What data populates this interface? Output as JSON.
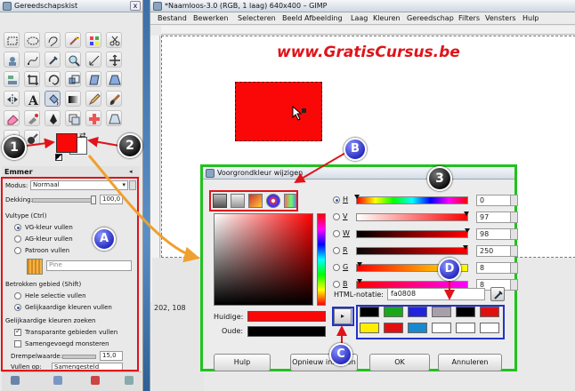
{
  "toolbox": {
    "title": "Gereedschapskist",
    "close": "x",
    "tools": [
      "rect-select-icon",
      "ellipse-select-icon",
      "lasso-icon",
      "fuzzy-select-icon",
      "color-select-icon",
      "scissors-icon",
      "foreground-select-icon",
      "paths-icon",
      "color-picker-icon",
      "zoom-icon",
      "measure-icon",
      "move-icon",
      "align-icon",
      "crop-icon",
      "rotate-icon",
      "scale-icon",
      "shear-icon",
      "perspective-icon",
      "flip-icon",
      "text-icon",
      "bucket-fill-icon",
      "blend-icon",
      "pencil-icon",
      "paintbrush-icon",
      "eraser-icon",
      "airbrush-icon",
      "ink-icon",
      "clone-icon",
      "heal-icon",
      "perspective-clone-icon",
      "smudge-icon",
      "dodge-icon"
    ],
    "fg_color": "#fa0808",
    "bg_color": "#ffffff"
  },
  "options": {
    "title": "Emmer",
    "mode_label": "Modus:",
    "mode_value": "Normaal",
    "opacity_label": "Dekking:",
    "opacity_value": "100,0",
    "fill_type_label": "Vultype  (Ctrl)",
    "fill_fg": "VG-kleur vullen",
    "fill_bg": "AG-kleur vullen",
    "fill_pattern": "Patroon vullen",
    "pattern_name": "Pine",
    "area_label": "Betrokken gebied  (Shift)",
    "area_selection": "Hele selectie vullen",
    "area_similar": "Gelijkaardige kleuren vullen",
    "similar_label": "Gelijkaardige kleuren zoeken",
    "transparent": "Transparante gebieden vullen",
    "sample_merged": "Samengevoegd monsteren",
    "threshold_label": "Drempelwaarde:",
    "threshold_value": "15,0",
    "fill_by_label": "Vullen op:",
    "fill_by_value": "Samengesteld"
  },
  "image_window": {
    "title": "*Naamloos-3.0 (RGB, 1 laag) 640x400 – GIMP",
    "menus": [
      "Bestand",
      "Bewerken",
      "Selecteren",
      "Beeld",
      "Afbeelding",
      "Laag",
      "Kleuren",
      "Gereedschap",
      "Filters",
      "Vensters",
      "Hulp"
    ],
    "watermark": "www.GratisCursus.be",
    "status_coords": "202, 108"
  },
  "dialog": {
    "title": "Voorgrondkleur wijzigen",
    "channels": [
      {
        "key": "H",
        "value": "0"
      },
      {
        "key": "V",
        "value": "97"
      },
      {
        "key": "W",
        "value": "98"
      },
      {
        "key": "R",
        "value": "250"
      },
      {
        "key": "G",
        "value": "8"
      },
      {
        "key": "B",
        "value": "8"
      }
    ],
    "html_label": "HTML-notatie:",
    "html_value": "fa0808",
    "current_label": "Huidige:",
    "old_label": "Oude:",
    "current_color": "#fa0808",
    "old_color": "#000000",
    "history_colors": [
      "#000000",
      "#1aa81a",
      "#2222dd",
      "#a8a0a8",
      "#000000",
      "#e11010",
      "#ffee00",
      "#e11010",
      "#1a88cc",
      "#ffffff",
      "#ffffff",
      "#ffffff"
    ],
    "buttons": {
      "help": "Hulp",
      "reset": "Opnieuw instellen",
      "ok": "OK",
      "cancel": "Annuleren"
    }
  },
  "annotations": {
    "one": "1",
    "two": "2",
    "three": "3",
    "A": "A",
    "B": "B",
    "C": "C",
    "D": "D"
  },
  "colors": {
    "annotation_red": "#e0131a",
    "annotation_blue": "#2233cc",
    "annotation_green": "#21c21e"
  }
}
